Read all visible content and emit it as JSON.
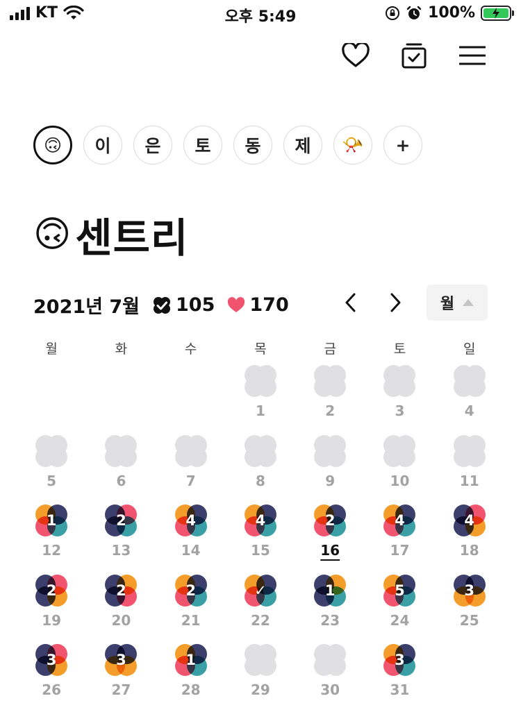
{
  "status_bar": {
    "carrier": "KT",
    "time": "오후 5:49",
    "battery": "100%"
  },
  "header_icons": [
    "heart-outline-icon",
    "checklist-icon",
    "hamburger-menu-icon"
  ],
  "chips": [
    {
      "label": "🙃",
      "active": true
    },
    {
      "label": "이"
    },
    {
      "label": "은"
    },
    {
      "label": "토"
    },
    {
      "label": "동"
    },
    {
      "label": "제"
    },
    {
      "label": "📯"
    },
    {
      "label": "+"
    }
  ],
  "goal": {
    "emoji": "🙃",
    "name": "센트리"
  },
  "summary": {
    "month_label": "2021년 7월",
    "check_count": "105",
    "heart_count": "170"
  },
  "view_selector": {
    "label": "월"
  },
  "weekdays": [
    "월",
    "화",
    "수",
    "목",
    "금",
    "토",
    "일"
  ],
  "colors": {
    "navy": "#3c3f6b",
    "pink": "#f0546e",
    "orange": "#f59d2a",
    "teal": "#3aa0a6",
    "empty": "#e0e0e2"
  },
  "calendar": {
    "leading_blanks": 3,
    "today": 16,
    "days": [
      {
        "day": "1",
        "count": "",
        "petals": [
          "empty",
          "empty",
          "empty",
          "empty"
        ]
      },
      {
        "day": "2",
        "count": "",
        "petals": [
          "empty",
          "empty",
          "empty",
          "empty"
        ]
      },
      {
        "day": "3",
        "count": "",
        "petals": [
          "empty",
          "empty",
          "empty",
          "empty"
        ]
      },
      {
        "day": "4",
        "count": "",
        "petals": [
          "empty",
          "empty",
          "empty",
          "empty"
        ]
      },
      {
        "day": "5",
        "count": "",
        "petals": [
          "empty",
          "empty",
          "empty",
          "empty"
        ]
      },
      {
        "day": "6",
        "count": "",
        "petals": [
          "empty",
          "empty",
          "empty",
          "empty"
        ]
      },
      {
        "day": "7",
        "count": "",
        "petals": [
          "empty",
          "empty",
          "empty",
          "empty"
        ]
      },
      {
        "day": "8",
        "count": "",
        "petals": [
          "empty",
          "empty",
          "empty",
          "empty"
        ]
      },
      {
        "day": "9",
        "count": "",
        "petals": [
          "empty",
          "empty",
          "empty",
          "empty"
        ]
      },
      {
        "day": "10",
        "count": "",
        "petals": [
          "empty",
          "empty",
          "empty",
          "empty"
        ]
      },
      {
        "day": "11",
        "count": "",
        "petals": [
          "empty",
          "empty",
          "empty",
          "empty"
        ]
      },
      {
        "day": "12",
        "count": "1",
        "petals": [
          "orange",
          "navy",
          "pink",
          "teal"
        ]
      },
      {
        "day": "13",
        "count": "2",
        "petals": [
          "navy",
          "pink",
          "navy",
          "teal"
        ]
      },
      {
        "day": "14",
        "count": "4",
        "petals": [
          "orange",
          "navy",
          "pink",
          "teal"
        ]
      },
      {
        "day": "15",
        "count": "4",
        "petals": [
          "orange",
          "navy",
          "pink",
          "teal"
        ]
      },
      {
        "day": "16",
        "count": "2",
        "petals": [
          "orange",
          "navy",
          "pink",
          "teal"
        ]
      },
      {
        "day": "17",
        "count": "4",
        "petals": [
          "orange",
          "navy",
          "pink",
          "teal"
        ]
      },
      {
        "day": "18",
        "count": "4",
        "petals": [
          "navy",
          "pink",
          "navy",
          "orange"
        ]
      },
      {
        "day": "19",
        "count": "2",
        "petals": [
          "navy",
          "pink",
          "navy",
          "orange"
        ]
      },
      {
        "day": "20",
        "count": "2",
        "petals": [
          "navy",
          "orange",
          "navy",
          "pink"
        ]
      },
      {
        "day": "21",
        "count": "2",
        "petals": [
          "orange",
          "navy",
          "pink",
          "teal"
        ]
      },
      {
        "day": "22",
        "count": "✓",
        "petals": [
          "orange",
          "navy",
          "pink",
          "teal"
        ]
      },
      {
        "day": "23",
        "count": "1",
        "petals": [
          "navy",
          "orange",
          "navy",
          "teal"
        ]
      },
      {
        "day": "24",
        "count": "5",
        "petals": [
          "orange",
          "navy",
          "pink",
          "teal"
        ]
      },
      {
        "day": "25",
        "count": "3",
        "petals": [
          "navy",
          "navy",
          "orange",
          "orange"
        ]
      },
      {
        "day": "26",
        "count": "3",
        "petals": [
          "navy",
          "pink",
          "navy",
          "orange"
        ]
      },
      {
        "day": "27",
        "count": "3",
        "petals": [
          "navy",
          "navy",
          "orange",
          "orange"
        ]
      },
      {
        "day": "28",
        "count": "1",
        "petals": [
          "orange",
          "navy",
          "pink",
          "teal"
        ]
      },
      {
        "day": "29",
        "count": "",
        "petals": [
          "empty",
          "empty",
          "empty",
          "empty"
        ]
      },
      {
        "day": "30",
        "count": "",
        "petals": [
          "empty",
          "empty",
          "empty",
          "empty"
        ]
      },
      {
        "day": "31",
        "count": "3",
        "petals": [
          "orange",
          "navy",
          "pink",
          "teal"
        ]
      }
    ]
  }
}
